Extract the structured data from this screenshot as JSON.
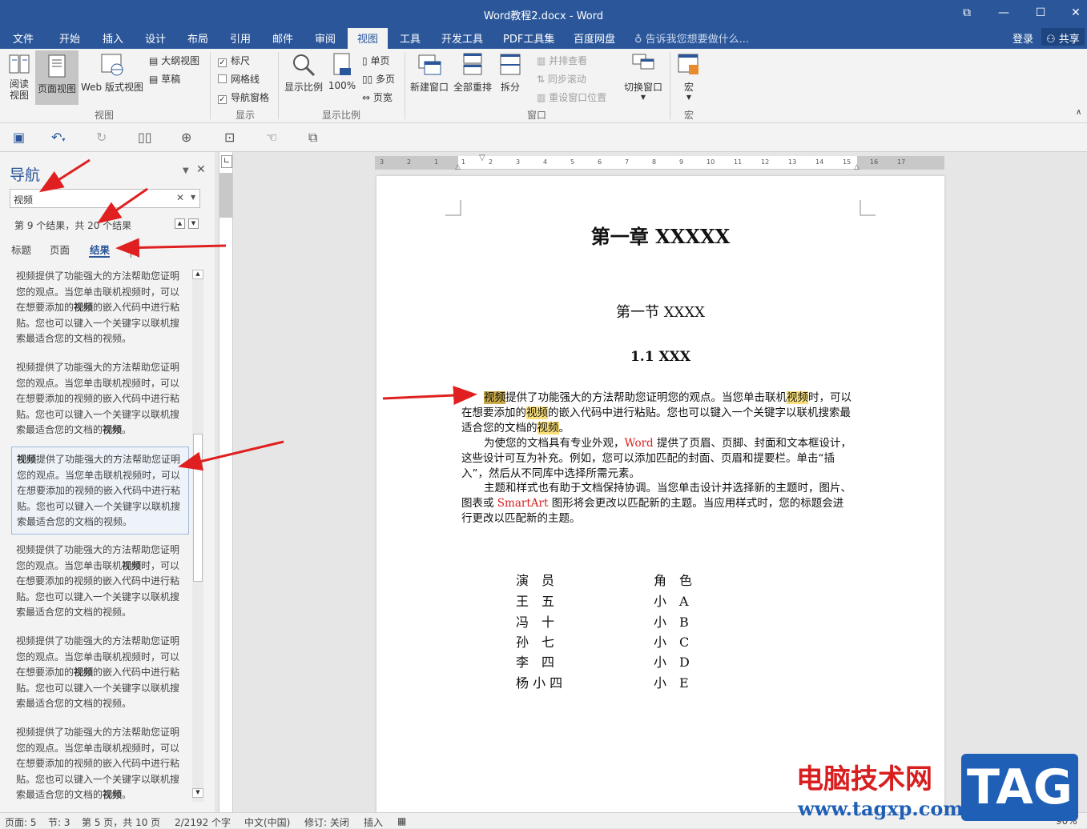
{
  "window": {
    "title": "Word教程2.docx - Word",
    "buttons": [
      "restore",
      "minimize",
      "maximize",
      "close"
    ]
  },
  "tabs": [
    "文件",
    "开始",
    "插入",
    "设计",
    "布局",
    "引用",
    "邮件",
    "审阅",
    "视图",
    "工具",
    "开发工具",
    "PDF工具集",
    "百度网盘"
  ],
  "active_tab": "视图",
  "tell_me": "告诉我您想要做什么...",
  "login": "登录",
  "share": "共享",
  "ribbon": {
    "view_group": {
      "label": "视图",
      "read_mode": "阅读\n视图",
      "print_layout": "页面视图",
      "web_layout": "Web 版式视图",
      "outline": "大纲视图",
      "draft": "草稿"
    },
    "show_group": {
      "label": "显示",
      "ruler": "标尺",
      "gridlines": "网格线",
      "nav_pane": "导航窗格",
      "ruler_checked": true,
      "gridlines_checked": false,
      "nav_checked": true
    },
    "zoom_group": {
      "label": "显示比例",
      "zoom": "显示比例",
      "hundred": "100%",
      "one_page": "单页",
      "multi_page": "多页",
      "page_width": "页宽"
    },
    "window_group": {
      "label": "窗口",
      "new_window": "新建窗口",
      "arrange_all": "全部重排",
      "split": "拆分",
      "side_by_side": "并排查看",
      "sync_scroll": "同步滚动",
      "reset_pos": "重设窗口位置",
      "switch_window": "切换窗口"
    },
    "macro_group": {
      "label": "宏",
      "macro": "宏"
    }
  },
  "nav": {
    "title": "导航",
    "search_value": "视频",
    "count": "第 9 个结果，共 20 个结果",
    "tabs": [
      "标题",
      "页面",
      "结果"
    ],
    "active": "结果",
    "results": [
      {
        "pre": "视频提供了功能强大的方法帮助您证明您的观点。当您单击联机视频时，可以在想要添加的",
        "bold": "视频",
        "post": "的嵌入代码中进行粘贴。您也可以键入一个关键字以联机搜索最适合您的文档的视频。"
      },
      {
        "pre": "视频提供了功能强大的方法帮助您证明您的观点。当您单击联机视频时，可以在想要添加的视频的嵌入代码中进行粘贴。您也可以键入一个关键字以联机搜索最适合您的文档的",
        "bold": "视频",
        "post": "。"
      },
      {
        "pre": "",
        "bold": "视频",
        "post": "提供了功能强大的方法帮助您证明您的观点。当您单击联机视频时，可以在想要添加的视频的嵌入代码中进行粘贴。您也可以键入一个关键字以联机搜索最适合您的文档的视频。"
      },
      {
        "pre": "视频提供了功能强大的方法帮助您证明您的观点。当您单击联机",
        "bold": "视频",
        "post": "时，可以在想要添加的视频的嵌入代码中进行粘贴。您也可以键入一个关键字以联机搜索最适合您的文档的视频。"
      },
      {
        "pre": "视频提供了功能强大的方法帮助您证明您的观点。当您单击联机视频时，可以在想要添加的",
        "bold": "视频",
        "post": "的嵌入代码中进行粘贴。您也可以键入一个关键字以联机搜索最适合您的文档的视频。"
      },
      {
        "pre": "视频提供了功能强大的方法帮助您证明您的观点。当您单击联机视频时，可以在想要添加的视频的嵌入代码中进行粘贴。您也可以键入一个关键字以联机搜索最适合您的文档的",
        "bold": "视频",
        "post": "。"
      }
    ]
  },
  "document": {
    "h1": "第一章  XXXXX",
    "h2": "第一节  XXXX",
    "h3": "1.1 XXX",
    "p1": [
      {
        "t": "视频",
        "c": "hl2"
      },
      {
        "t": "提供了功能强大的方法帮助您证明您的观点。当您单击联机"
      },
      {
        "t": "视频",
        "c": "hl"
      },
      {
        "t": "时，可以在想要添加的"
      },
      {
        "t": "视频",
        "c": "hl"
      },
      {
        "t": "的嵌入代码中进行粘贴。您也可以键入一个关键字以联机搜索最适合您的文档的"
      },
      {
        "t": "视频",
        "c": "hl"
      },
      {
        "t": "。"
      }
    ],
    "p2": [
      {
        "t": "为使您的文档具有专业外观，"
      },
      {
        "t": "Word",
        "c": "red"
      },
      {
        "t": " 提供了页眉、页脚、封面和文本框设计，这些设计可互为补充。例如，您可以添加匹配的封面、页眉和提要栏。单击“插入”，然后从不同库中选择所需元素。"
      }
    ],
    "p3": [
      {
        "t": "主题和样式也有助于文档保持协调。当您单击设计并选择新的主题时，图片、图表或 "
      },
      {
        "t": "SmartArt",
        "c": "red"
      },
      {
        "t": " 图形将会更改以匹配新的主题。当应用样式时，您的标题会进行更改以匹配新的主题。"
      }
    ],
    "table": [
      [
        "演　员",
        "角　色"
      ],
      [
        "王　五",
        "小　A"
      ],
      [
        "冯　十",
        "小　B"
      ],
      [
        "孙　七",
        "小　C"
      ],
      [
        "李　四",
        "小　D"
      ],
      [
        "杨 小 四",
        "小　E"
      ]
    ]
  },
  "ruler_labels": [
    "3",
    "2",
    "1",
    "1",
    "2",
    "3",
    "4",
    "5",
    "6",
    "7",
    "8",
    "9",
    "10",
    "11",
    "12",
    "13",
    "14",
    "15",
    "16",
    "17"
  ],
  "status": {
    "page": "页面: 5",
    "section": "节: 3",
    "pages": "第 5 页，共 10 页",
    "words": "2/2192 个字",
    "lang": "中文(中国)",
    "track": "修订: 关闭",
    "insert": "插入",
    "zoom": "90%"
  },
  "watermark": {
    "line1": "电脑技术网",
    "line2": "www.tagxp.com",
    "tag": "TAG"
  }
}
